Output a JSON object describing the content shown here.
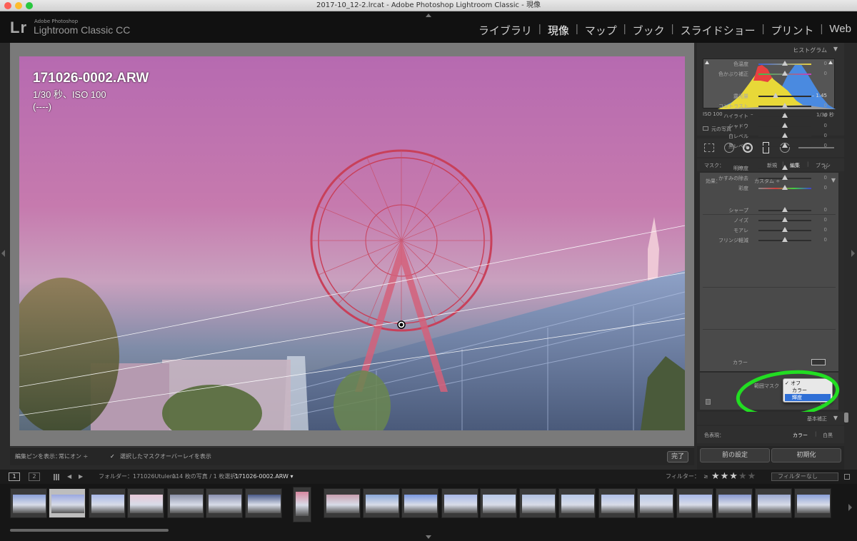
{
  "window": {
    "title": "2017-10_12-2.lrcat - Adobe Photoshop Lightroom Classic - 現像"
  },
  "app": {
    "logo": "Lr",
    "vendor": "Adobe Photoshop",
    "name": "Lightroom Classic CC"
  },
  "modules": [
    {
      "label": "ライブラリ",
      "active": false
    },
    {
      "label": "現像",
      "active": true
    },
    {
      "label": "マップ",
      "active": false
    },
    {
      "label": "ブック",
      "active": false
    },
    {
      "label": "スライドショー",
      "active": false
    },
    {
      "label": "プリント",
      "active": false
    },
    {
      "label": "Web",
      "active": false
    }
  ],
  "photo": {
    "filename": "171026-0002.ARW",
    "exif": "1/30 秒、ISO 100",
    "extra": "(----)"
  },
  "toolbar": {
    "pin_label": "編集ピンを表示：",
    "pin_value": "常にオン ÷",
    "overlay_checkbox_label": "選択したマスクオーバーレイを表示",
    "done_label": "完了"
  },
  "histogram": {
    "title": "ヒストグラム",
    "iso": "ISO 100",
    "dash1": "–",
    "dash2": "–",
    "shutter": "1/30 秒",
    "original_label": "元の写真"
  },
  "mask": {
    "label": "マスク：",
    "new": "新規",
    "edit": "編集",
    "brush": "ブラシ"
  },
  "effects": {
    "label": "効果：",
    "preset": "カスタム ÷",
    "sliders": [
      {
        "label": "色温度",
        "value": "0",
        "pos": 0.5,
        "track": "temp"
      },
      {
        "label": "色かぶり補正",
        "value": "0",
        "pos": 0.5,
        "track": "tint"
      },
      {
        "label": "露光量",
        "value": "– 1.45",
        "pos": 0.32,
        "track": "gray"
      },
      {
        "label": "コントラスト",
        "value": "0",
        "pos": 0.5,
        "track": "gray"
      },
      {
        "label": "ハイライト",
        "value": "0",
        "pos": 0.5,
        "track": "gray"
      },
      {
        "label": "シャドウ",
        "value": "0",
        "pos": 0.5,
        "track": "gray"
      },
      {
        "label": "白レベル",
        "value": "0",
        "pos": 0.5,
        "track": "gray"
      },
      {
        "label": "黒レベル",
        "value": "0",
        "pos": 0.5,
        "track": "gray"
      },
      {
        "label": "明瞭度",
        "value": "0",
        "pos": 0.5,
        "track": "gray"
      },
      {
        "label": "かすみの除去",
        "value": "0",
        "pos": 0.5,
        "track": "gray"
      },
      {
        "label": "彩度",
        "value": "0",
        "pos": 0.5,
        "track": "sat"
      },
      {
        "label": "シャープ",
        "value": "0",
        "pos": 0.5,
        "track": "gray"
      },
      {
        "label": "ノイズ",
        "value": "0",
        "pos": 0.5,
        "track": "gray"
      },
      {
        "label": "モアレ",
        "value": "0",
        "pos": 0.5,
        "track": "gray"
      },
      {
        "label": "フリンジ軽減",
        "value": "0",
        "pos": 0.5,
        "track": "gray"
      }
    ],
    "color_label": "カラー"
  },
  "range_mask": {
    "label": "範囲マスク",
    "options": [
      {
        "label": "オフ",
        "checked": true,
        "highlighted": false
      },
      {
        "label": "カラー",
        "checked": false,
        "highlighted": false
      },
      {
        "label": "輝度",
        "checked": false,
        "highlighted": true
      }
    ],
    "trailing": "し"
  },
  "basic": {
    "title": "基本補正",
    "treatment_label": "色表現：",
    "color": "カラー",
    "bw": "白黒"
  },
  "buttons": {
    "previous": "前の設定",
    "reset": "初期化"
  },
  "filmstrip_bar": {
    "page1": "1",
    "page2": "2",
    "folder_label": "フォルダー：171026Utulens",
    "count": "114 枚の写真 / 1 枚選択 /",
    "selected_file": "171026-0002.ARW ▾",
    "filter_label": "フィルター：",
    "rating_op": "≥",
    "rating": 3,
    "filter_value": "フィルターなし"
  },
  "colors": {
    "accent_highlight": "#2f6fd6",
    "annotation_circle": "#22dd22",
    "overlay": "#d36fb8"
  }
}
